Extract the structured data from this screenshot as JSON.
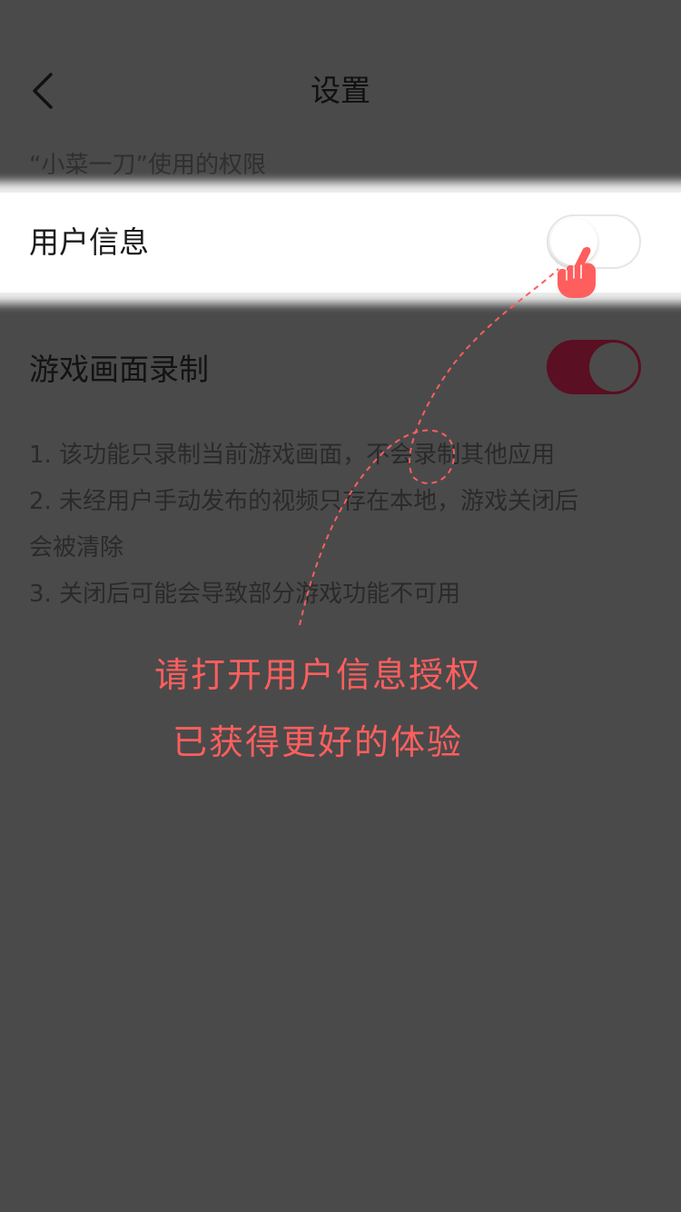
{
  "header": {
    "title": "设置",
    "back_icon": "chevron-left-icon"
  },
  "section": {
    "label": "“小菜一刀”使用的权限"
  },
  "settings": {
    "user_info": {
      "label": "用户信息",
      "enabled": false
    },
    "game_recording": {
      "label": "游戏画面录制",
      "enabled": true
    }
  },
  "notes": [
    "1. 该功能只录制当前游戏画面，不会录制其他应用",
    "2. 未经用户手动发布的视频只存在本地，游戏关闭后",
    "会被清除",
    "3. 关闭后可能会导致部分游戏功能不可用"
  ],
  "guide": {
    "line1": "请打开用户信息授权",
    "line2": "已获得更好的体验",
    "pointer_icon": "hand-pointer-icon"
  },
  "colors": {
    "overlay_bg": "#4a4a4a",
    "guide_accent": "#ff5e5e",
    "toggle_on": "#5a0f22"
  }
}
